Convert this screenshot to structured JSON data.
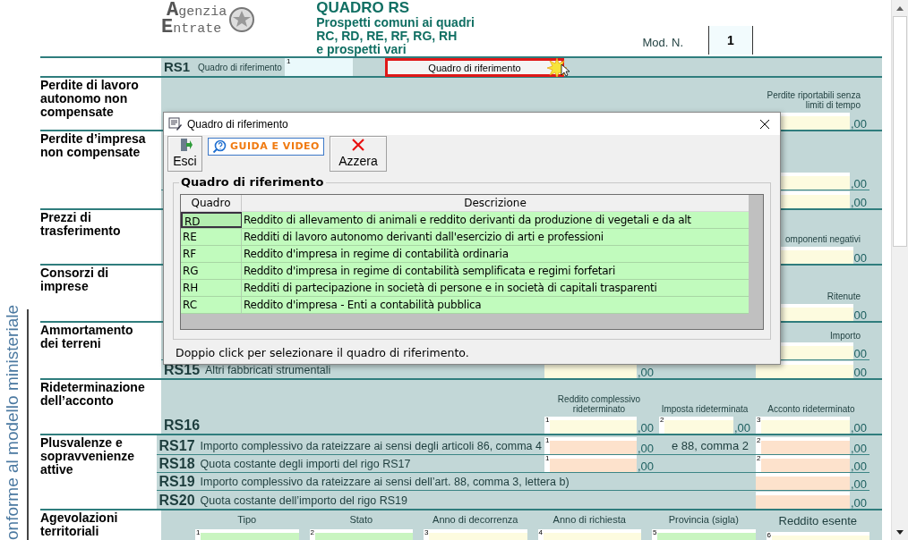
{
  "header": {
    "logo": [
      {
        "initial": "A",
        "rest": "genzia"
      },
      {
        "initial": "E",
        "rest": "ntrate"
      }
    ],
    "title": "QUADRO RS",
    "subtitle_lines": [
      "Prospetti comuni ai quadri",
      "RC, RD, RE, RF, RG, RH",
      "e prospetti vari"
    ],
    "mod_label": "Mod. N.",
    "mod_value": "1"
  },
  "side_text": "onforme al modello ministeriale",
  "rs1": {
    "code": "RS1",
    "label": "Quadro di riferimento",
    "field_number": "1",
    "button": "Quadro di riferimento"
  },
  "sections": [
    {
      "kind": "rows",
      "title": "Perdite di lavoro autonomo non compensate",
      "side_header": "Perdite riportabili senza limiti di tempo",
      "rows": [
        {
          "cells": [
            null,
            null,
            {
              "kind": "yellow",
              "value": ",00"
            }
          ]
        }
      ]
    },
    {
      "kind": "rows",
      "title": "Perdite d’impresa non compensate",
      "rows": [
        {
          "cells": [
            null,
            null,
            {
              "kind": "yellow",
              "value": ",00"
            }
          ]
        },
        {
          "cells": [
            null,
            null,
            {
              "kind": "yellow",
              "value": ",00"
            }
          ]
        }
      ]
    },
    {
      "kind": "rows",
      "title": "Prezzi di trasferimento",
      "side_header": "omponenti negativi",
      "rows": [
        {
          "cells": [
            null,
            null,
            {
              "kind": "yellow",
              "value": "00"
            }
          ]
        }
      ]
    },
    {
      "kind": "rows",
      "title": "Consorzi di imprese",
      "side_header": "Ritenute",
      "rows": [
        {
          "cells": [
            null,
            null,
            {
              "kind": "yellow",
              "value": "00"
            }
          ]
        }
      ]
    },
    {
      "kind": "rows",
      "title": "Ammortamento dei terreni",
      "side_header": "Importo",
      "rows": [
        {
          "cells": [
            null,
            null,
            {
              "kind": "yellow",
              "value": "00"
            }
          ]
        },
        {
          "code": "RS15",
          "label": "Altri fabbricati strumentali",
          "cells": [
            {
              "kind": "yellow",
              "value": ",00"
            },
            null,
            {
              "kind": "yellow",
              "value": "00"
            }
          ]
        }
      ]
    },
    {
      "kind": "rows",
      "title": "Rideterminazione dell’acconto",
      "headers": [
        {
          "text": "Reddito complessivo rideterminato"
        },
        {
          "text": "Imposta rideterminata"
        },
        {
          "text": "Acconto rideterminato"
        }
      ],
      "rows": [
        {
          "code": "RS16",
          "cells": [
            {
              "kind": "yellow",
              "number": "1",
              "value": ",00"
            },
            {
              "kind": "yellow",
              "number": "2",
              "value": ",00"
            },
            {
              "kind": "yellow",
              "number": "3",
              "value": ",00"
            }
          ]
        }
      ]
    },
    {
      "kind": "rows",
      "title": "Plusvalenze e sopravvenienze attive",
      "rows": [
        {
          "code": "RS17",
          "label": "Importo complessivo da rateizzare ai sensi degli articoli 86, comma 4",
          "cells": [
            {
              "kind": "orange",
              "number": "1",
              "value": ",00"
            },
            {
              "kind": "text",
              "text": "e 88, comma 2"
            },
            {
              "kind": "orange",
              "number": "2",
              "value": ",00"
            }
          ]
        },
        {
          "code": "RS18",
          "label": "Quota costante degli importi del rigo RS17",
          "cells": [
            {
              "kind": "orange",
              "number": "1",
              "value": ",00"
            },
            null,
            {
              "kind": "orange",
              "number": "2",
              "value": ",00"
            }
          ]
        },
        {
          "code": "RS19",
          "label": "Importo complessivo da rateizzare ai sensi dell’art. 88, comma 3, lettera b)",
          "cells": [
            null,
            null,
            {
              "kind": "orange",
              "value": ",00"
            }
          ]
        },
        {
          "code": "RS20",
          "label": "Quota costante dell’importo del rigo RS19",
          "cells": [
            null,
            null,
            {
              "kind": "orange",
              "value": ",00"
            }
          ]
        }
      ]
    },
    {
      "kind": "columns",
      "title": "Agevolazioni territoriali",
      "columns": [
        {
          "header": "Tipo",
          "number": "1",
          "kind": "green"
        },
        {
          "header": "Stato",
          "number": "2",
          "kind": "green"
        },
        {
          "header": "Anno di decorrenza",
          "number": "3",
          "kind": "yellow"
        },
        {
          "header": "Anno di richiesta",
          "number": "4",
          "kind": "yellow"
        },
        {
          "header": "Provincia (sigla)",
          "number": "5",
          "kind": "green"
        },
        {
          "header": "Reddito esente",
          "number": "6",
          "kind": "yellow"
        }
      ]
    }
  ],
  "dialog": {
    "title": "Quadro di riferimento",
    "buttons": [
      {
        "kind": "exit",
        "label": "Esci"
      },
      {
        "kind": "guide",
        "label": "GUIDA E VIDEO"
      },
      {
        "kind": "reset",
        "label": "Azzera"
      }
    ],
    "group_title": "Quadro di riferimento",
    "columns": [
      "Quadro",
      "Descrizione"
    ],
    "rows": [
      {
        "code": "RD",
        "description": "Reddito di allevamento di animali e reddito derivanti da produzione di vegetali e da alt",
        "selected": true
      },
      {
        "code": "RE",
        "description": "Redditi di lavoro autonomo derivanti dall'esercizio di arti e professioni",
        "selected": false
      },
      {
        "code": "RF",
        "description": "Reddito d'impresa in regime di contabilità ordinaria",
        "selected": false
      },
      {
        "code": "RG",
        "description": "Reddito d'impresa in regime di contabilità semplificata e regimi forfetari",
        "selected": false
      },
      {
        "code": "RH",
        "description": "Redditi di partecipazione in società di persone e in società di capitali trasparenti",
        "selected": false
      },
      {
        "code": "RC",
        "description": "Reddito d'impresa - Enti a contabilità pubblica",
        "selected": false
      }
    ],
    "hint": "Doppio click per selezionare il quadro di riferimento."
  }
}
